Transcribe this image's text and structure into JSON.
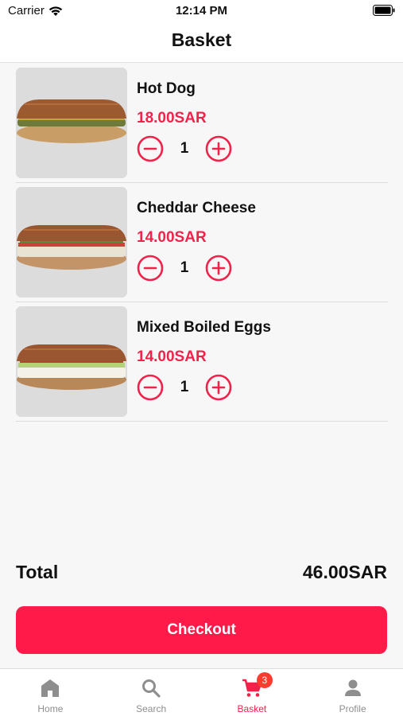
{
  "status_bar": {
    "carrier": "Carrier",
    "time": "12:14 PM"
  },
  "nav": {
    "title": "Basket"
  },
  "items": [
    {
      "name": "Hot Dog",
      "price": "18.00SAR",
      "quantity": "1"
    },
    {
      "name": "Cheddar Cheese",
      "price": "14.00SAR",
      "quantity": "1"
    },
    {
      "name": "Mixed Boiled Eggs",
      "price": "14.00SAR",
      "quantity": "1"
    }
  ],
  "summary": {
    "total_label": "Total",
    "total_value": "46.00SAR"
  },
  "checkout": {
    "label": "Checkout"
  },
  "tabs": [
    {
      "label": "Home",
      "icon": "home-icon"
    },
    {
      "label": "Search",
      "icon": "search-icon"
    },
    {
      "label": "Basket",
      "icon": "cart-icon",
      "badge": "3",
      "active": true
    },
    {
      "label": "Profile",
      "icon": "person-icon"
    }
  ],
  "colors": {
    "accent": "#f0234b",
    "button": "#ff1a4a",
    "badge": "#ff3b30"
  }
}
